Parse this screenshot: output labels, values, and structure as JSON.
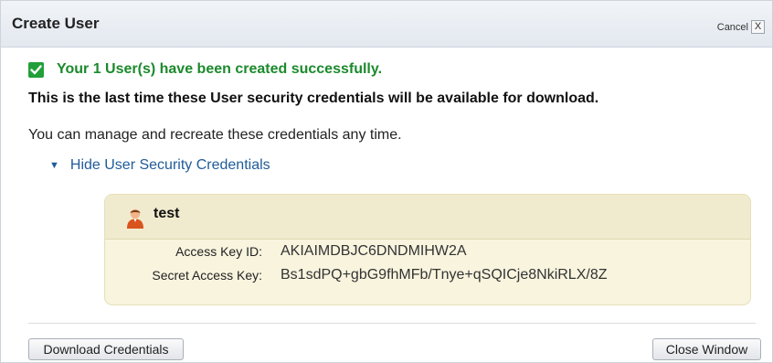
{
  "dialog": {
    "title": "Create User",
    "cancel_label": "Cancel",
    "close_glyph": "X"
  },
  "message": {
    "success": "Your 1 User(s) have been created successfully.",
    "warning": "This is the last time these User security credentials will be available for download.",
    "info": "You can manage and recreate these credentials any time.",
    "toggle_label": "Hide User Security Credentials"
  },
  "credentials": {
    "username": "test",
    "access_key_id_label": "Access Key ID:",
    "access_key_id": "AKIAIMDBJC6DNDMIHW2A",
    "secret_access_key_label": "Secret Access Key:",
    "secret_access_key": "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"
  },
  "footer": {
    "download_button": "Download Credentials",
    "close_button": "Close Window"
  },
  "icons": {
    "success": "check-icon",
    "toggle": "triangle-down-icon",
    "user": "user-icon",
    "close": "close-icon"
  },
  "colors": {
    "success_green": "#1b8a2c",
    "link_blue": "#1f5c99",
    "credential_panel": "#f8f4de"
  }
}
